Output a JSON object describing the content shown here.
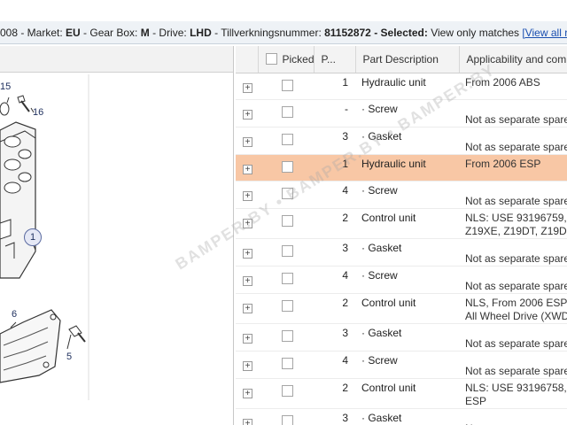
{
  "header": {
    "seg1_label": "008 - Market: ",
    "market": "EU",
    "seg2_label": " - Gear Box: ",
    "gearbox": "M",
    "seg3_label": " - Drive: ",
    "drive": "LHD",
    "seg4_label": " - Tillverkningsnummer: ",
    "number": "81152872",
    "seg5_label": " - Selected: ",
    "selected_text": "View only matches",
    "view_all_link": "[View all resu"
  },
  "diagram": {
    "callouts": [
      "15",
      "16",
      "1",
      "6",
      "5"
    ]
  },
  "table": {
    "columns": {
      "picked": "Picked",
      "pos": "P...",
      "desc": "Part Description",
      "app": "Applicability and comm"
    },
    "rows": [
      {
        "pos": "1",
        "desc": "Hydraulic unit",
        "app1": "From 2006 ABS",
        "app2": "",
        "selected": false
      },
      {
        "pos": "-",
        "desc": "· Screw",
        "app1": "",
        "app2": "Not as separate spare",
        "selected": false
      },
      {
        "pos": "3",
        "desc": "· Gasket",
        "app1": "",
        "app2": "Not as separate spare",
        "selected": false
      },
      {
        "pos": "1",
        "desc": "Hydraulic unit",
        "app1": "From 2006 ESP",
        "app2": "",
        "selected": true
      },
      {
        "pos": "4",
        "desc": "· Screw",
        "app1": "",
        "app2": "Not as separate spare",
        "selected": false
      },
      {
        "pos": "2",
        "desc": "Control unit",
        "app1": "NLS: USE 93196759,",
        "app2": "Z19XE, Z19DT, Z19DT",
        "selected": false
      },
      {
        "pos": "3",
        "desc": "· Gasket",
        "app1": "",
        "app2": "Not as separate spare",
        "selected": false
      },
      {
        "pos": "4",
        "desc": "· Screw",
        "app1": "",
        "app2": "Not as separate spare",
        "selected": false
      },
      {
        "pos": "2",
        "desc": "Control unit",
        "app1": "NLS, From 2006 ESP",
        "app2": "All Wheel Drive (XWD",
        "selected": false
      },
      {
        "pos": "3",
        "desc": "· Gasket",
        "app1": "",
        "app2": "Not as separate spare",
        "selected": false
      },
      {
        "pos": "4",
        "desc": "· Screw",
        "app1": "",
        "app2": "Not as separate spare",
        "selected": false
      },
      {
        "pos": "2",
        "desc": "Control unit",
        "app1": "NLS: USE 93196758,",
        "app2": "ESP",
        "selected": false
      },
      {
        "pos": "3",
        "desc": "· Gasket",
        "app1": "",
        "app2": "Not as separate spare",
        "selected": false
      }
    ]
  },
  "watermark": "BAMPER.BY • BAMPER.BY • BAMPER.BY"
}
